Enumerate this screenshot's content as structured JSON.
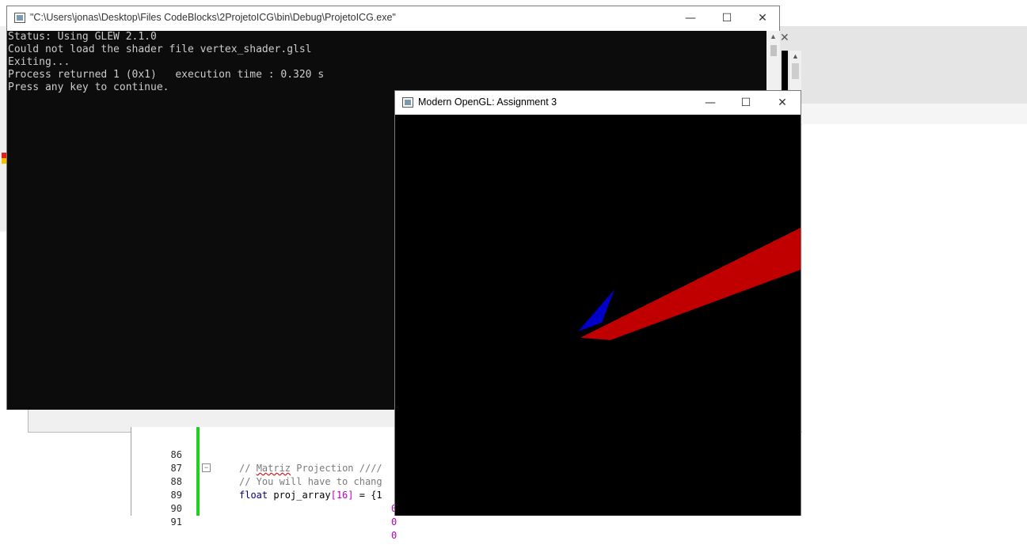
{
  "console_window": {
    "title": "\"C:\\Users\\jonas\\Desktop\\Files CodeBlocks\\2ProjetoICG\\bin\\Debug\\ProjetoICG.exe\"",
    "minimize": "—",
    "maximize": "☐",
    "close": "✕",
    "lines": [
      "Status: Using GLEW 2.1.0",
      "Could not load the shader file vertex_shader.glsl",
      "Exiting...",
      "Process returned 1 (0x1)   execution time : 0.320 s",
      "Press any key to continue."
    ],
    "colors": {
      "background": "#0c0c0c",
      "text": "#cccccc"
    }
  },
  "gl_window": {
    "title": "Modern OpenGL: Assignment 3",
    "minimize": "—",
    "maximize": "☐",
    "close": "✕",
    "scene": {
      "background": "#000000",
      "shapes": [
        {
          "name": "red-triangle",
          "color": "#c00000"
        },
        {
          "name": "blue-triangle",
          "color": "#0000c8"
        }
      ]
    }
  },
  "code_editor": {
    "lines": [
      {
        "num": "86",
        "pre": "// ",
        "squig": "Matriz",
        "post": " Projection ////"
      },
      {
        "num": "87",
        "text": "// You will have to chang"
      },
      {
        "num": "88",
        "kw": "float",
        "rest": " proj_array",
        "num_part": "[16]",
        "end": " = {1"
      },
      {
        "num": "89",
        "text": "0"
      },
      {
        "num": "90",
        "text": "0"
      },
      {
        "num": "91",
        "text": "0"
      }
    ],
    "colors": {
      "gutter_marker": "#20d020"
    }
  },
  "background_window": {
    "close": "✕"
  }
}
